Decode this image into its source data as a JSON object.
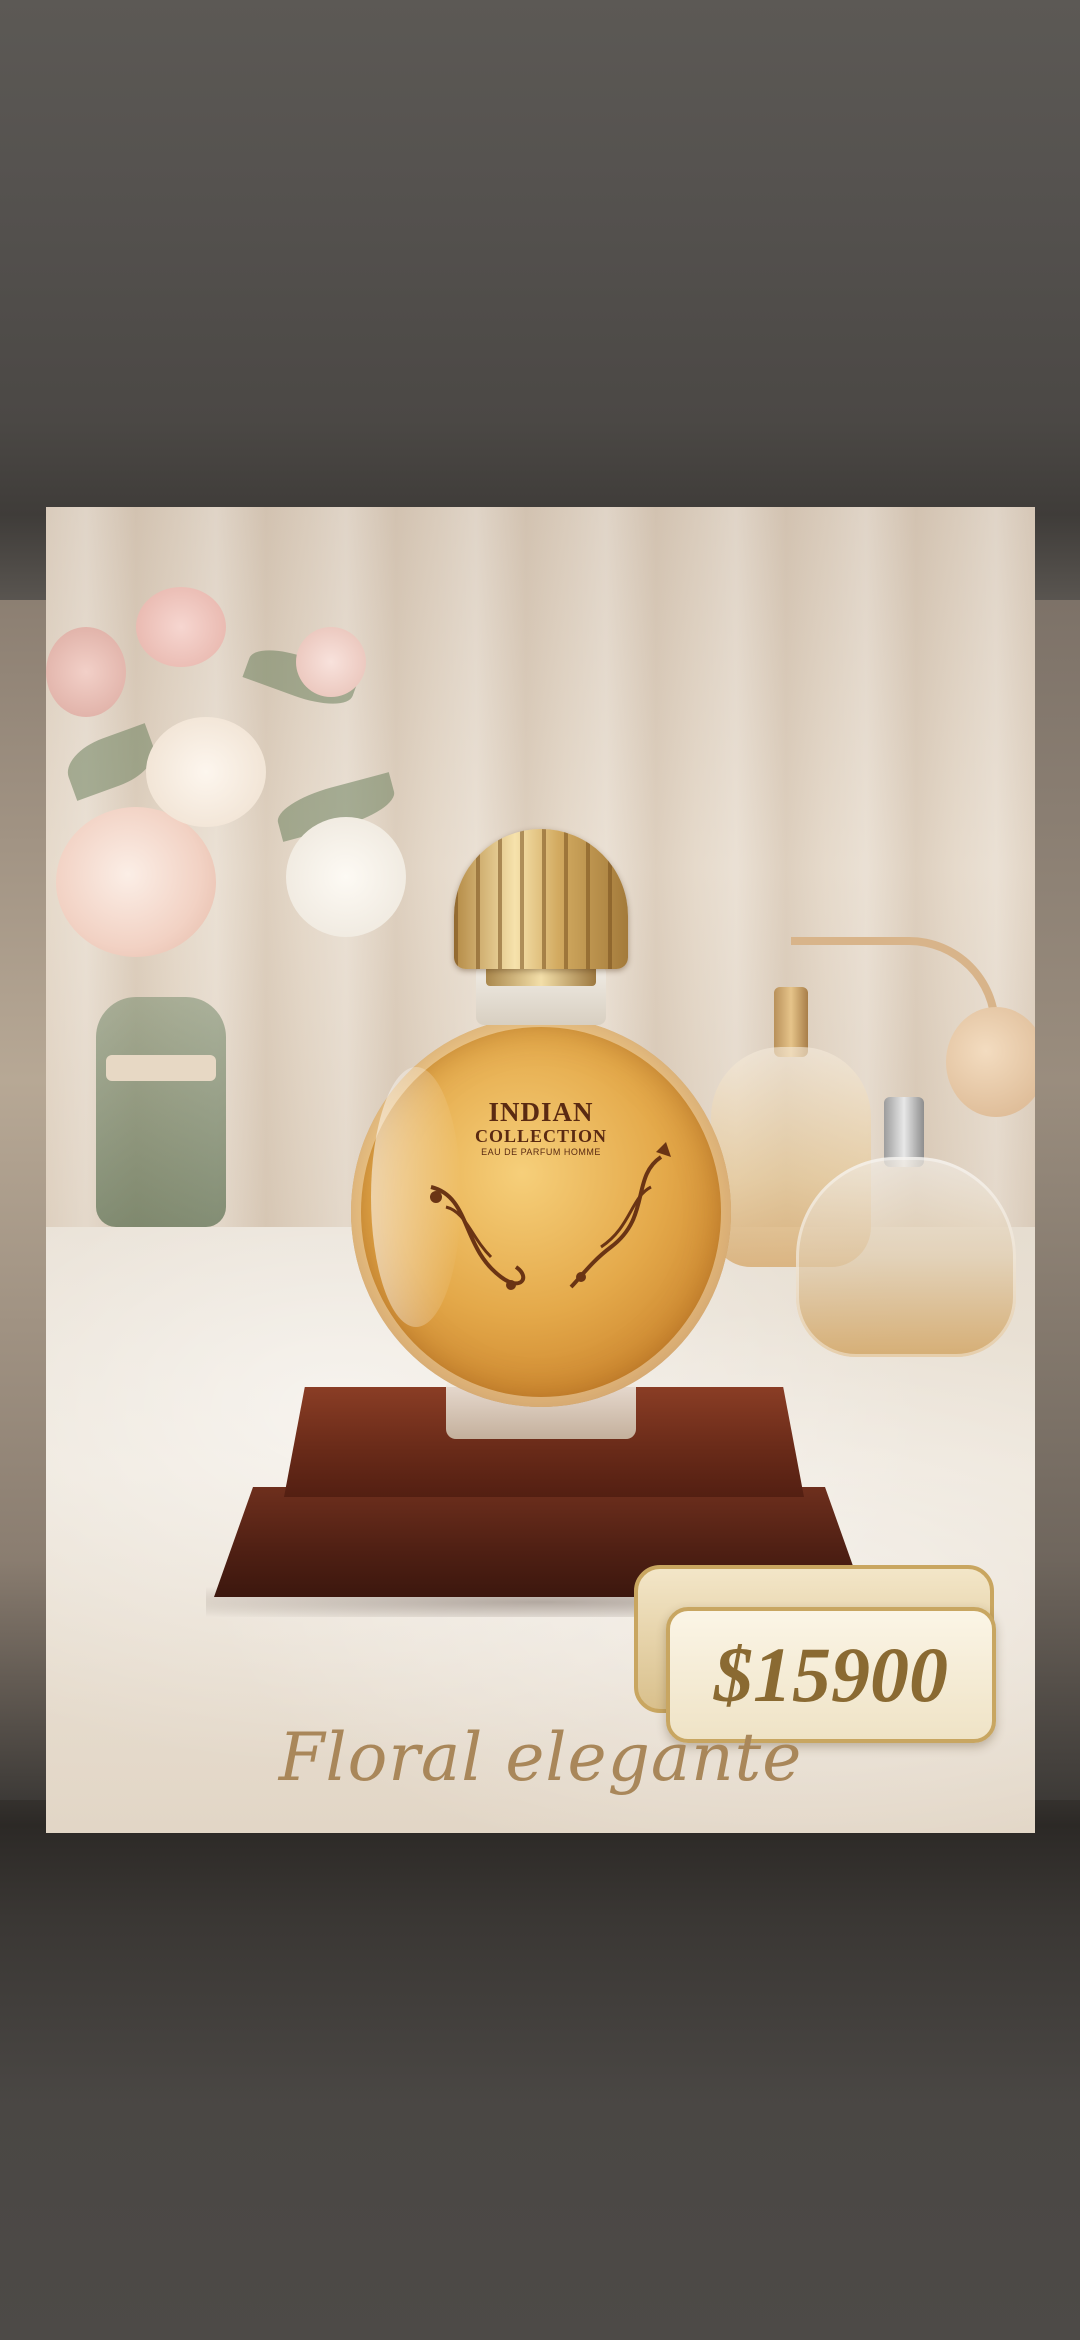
{
  "product": {
    "brand": "INDIAN",
    "line": "COLLECTION",
    "sub_label": "EAU DE PARFUM HOMME"
  },
  "price": {
    "display": "$15900"
  },
  "caption": {
    "text": "Floral elegante"
  },
  "colors": {
    "background": "#4a4744",
    "gold_text": "#8a6a32",
    "caption_gold": "#a9875a",
    "wood": "#6a2b19",
    "perfume_amber": "#e4a94a"
  }
}
